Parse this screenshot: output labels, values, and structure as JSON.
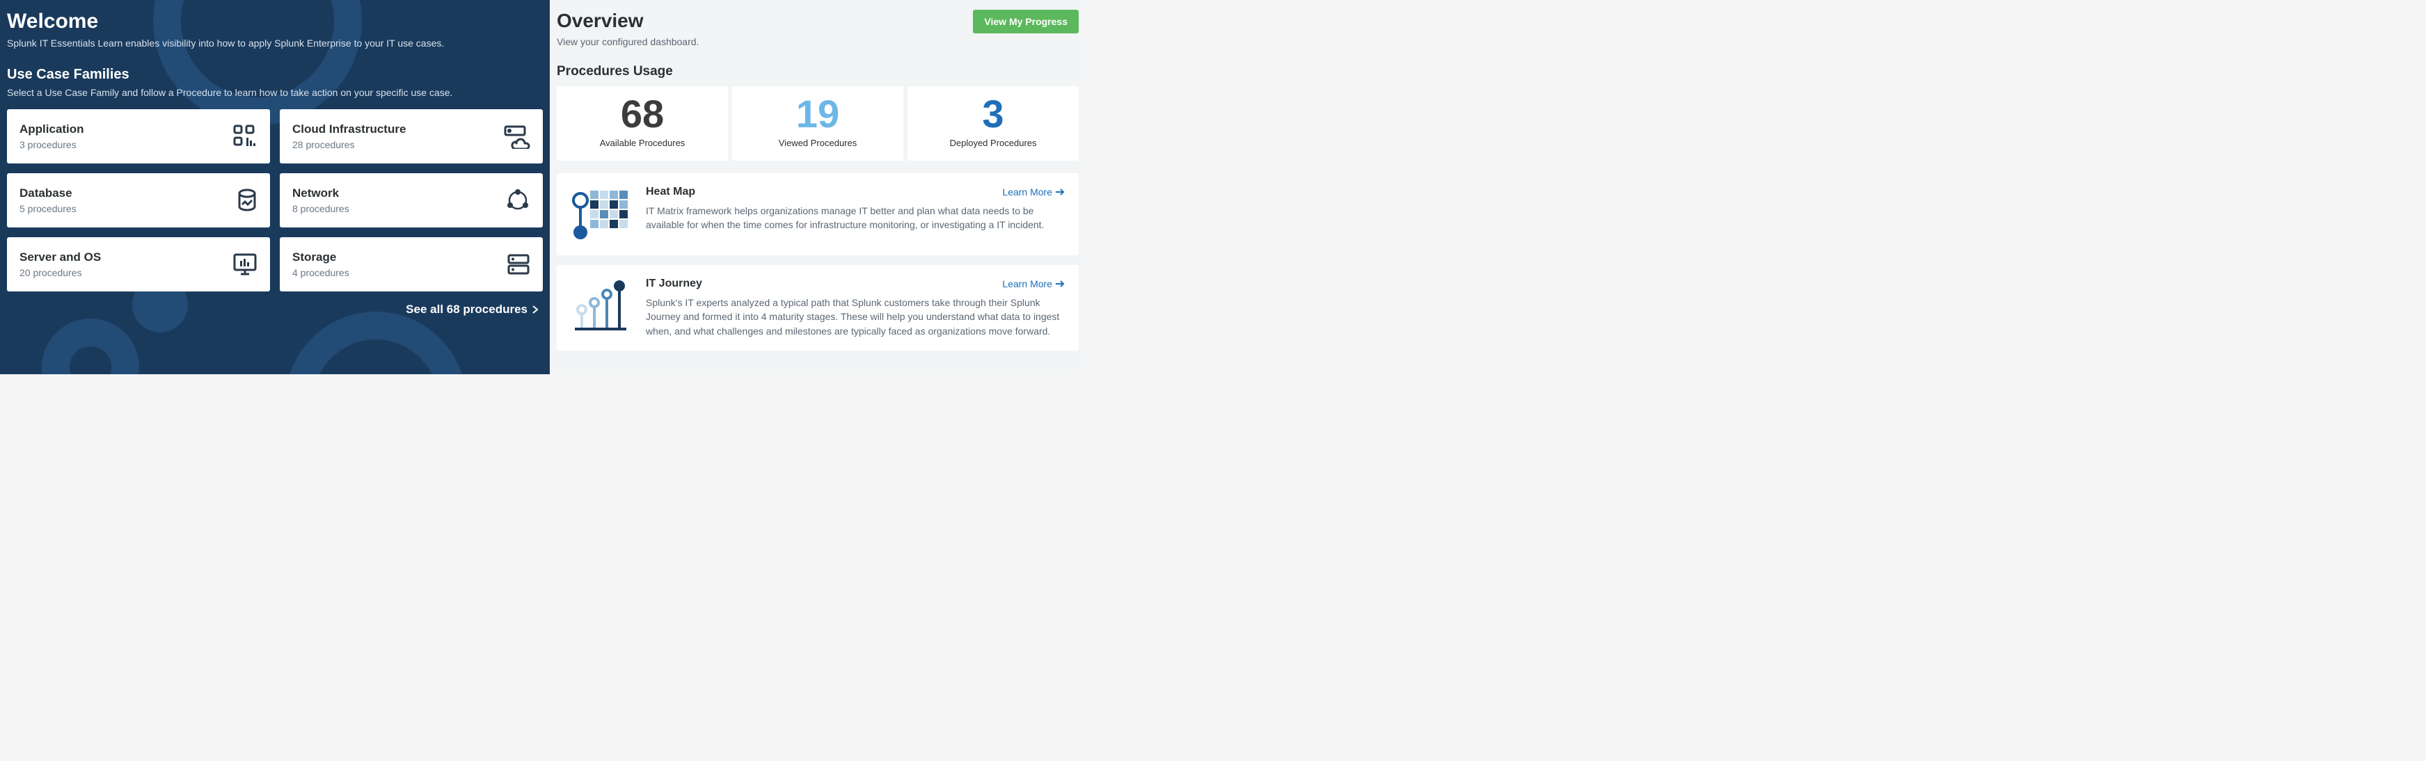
{
  "welcome": {
    "title": "Welcome",
    "subtitle": "Splunk IT Essentials Learn enables visibility into how to apply Splunk Enterprise to your IT use cases."
  },
  "use_case_families": {
    "title": "Use Case Families",
    "subtitle": "Select a Use Case Family and follow a Procedure to learn how to take action on your specific use case.",
    "cards": [
      {
        "title": "Application",
        "procedures": "3 procedures"
      },
      {
        "title": "Cloud Infrastructure",
        "procedures": "28 procedures"
      },
      {
        "title": "Database",
        "procedures": "5 procedures"
      },
      {
        "title": "Network",
        "procedures": "8 procedures"
      },
      {
        "title": "Server and OS",
        "procedures": "20 procedures"
      },
      {
        "title": "Storage",
        "procedures": "4 procedures"
      }
    ],
    "see_all": "See all 68 procedures"
  },
  "overview": {
    "title": "Overview",
    "subtitle": "View your configured dashboard.",
    "button": "View My Progress"
  },
  "procedures_usage": {
    "title": "Procedures Usage",
    "stats": [
      {
        "value": "68",
        "label": "Available Procedures"
      },
      {
        "value": "19",
        "label": "Viewed Procedures"
      },
      {
        "value": "3",
        "label": "Deployed Procedures"
      }
    ]
  },
  "info_cards": {
    "heat_map": {
      "title": "Heat Map",
      "learn_more": "Learn More",
      "description": "IT Matrix framework helps organizations manage IT better and plan what data needs to be available for when the time comes for infrastructure monitoring, or investigating a IT incident."
    },
    "it_journey": {
      "title": "IT Journey",
      "learn_more": "Learn More",
      "description": "Splunk's IT experts analyzed a typical path that Splunk customers take through their Splunk Journey and formed it into 4 maturity stages. These will help you understand what data to ingest when, and what challenges and milestones are typically faced as organizations move forward."
    }
  }
}
